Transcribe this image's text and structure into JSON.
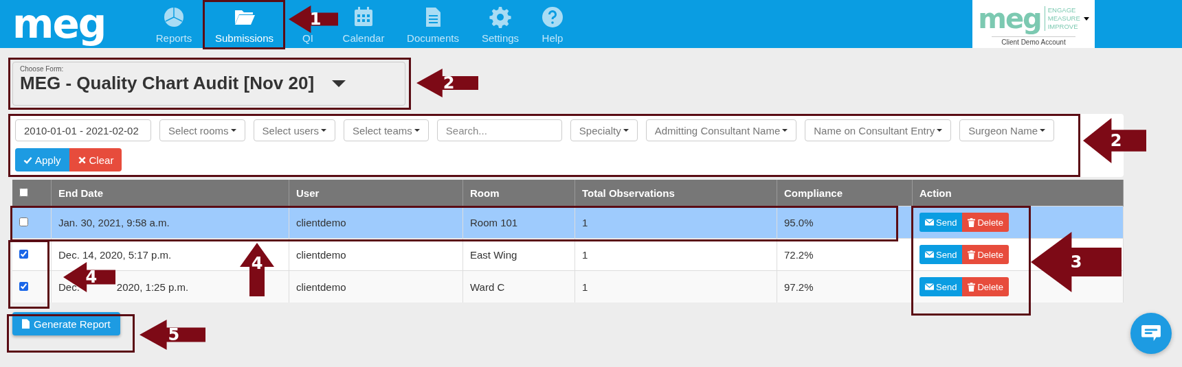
{
  "brand": "meg",
  "nav": [
    {
      "label": "Reports",
      "selected": false
    },
    {
      "label": "Submissions",
      "selected": true
    },
    {
      "label": "QI",
      "selected": false
    },
    {
      "label": "Calendar",
      "selected": false
    },
    {
      "label": "Documents",
      "selected": false
    },
    {
      "label": "Settings",
      "selected": false
    },
    {
      "label": "Help",
      "selected": false
    }
  ],
  "account": {
    "logo": "meg",
    "tagline": [
      "ENGAGE",
      "MEASURE",
      "IMPROVE"
    ],
    "name": "Client Demo Account"
  },
  "form_chooser": {
    "label": "Choose Form:",
    "value": "MEG - Quality Chart Audit [Nov 20]"
  },
  "filters": [
    {
      "kind": "value",
      "text": "2010-01-01 - 2021-02-02"
    },
    {
      "kind": "dropdown",
      "text": "Select rooms"
    },
    {
      "kind": "dropdown",
      "text": "Select users"
    },
    {
      "kind": "dropdown",
      "text": "Select teams"
    },
    {
      "kind": "search",
      "placeholder": "Search..."
    },
    {
      "kind": "dropdown",
      "text": "Specialty"
    },
    {
      "kind": "dropdown",
      "text": "Admitting Consultant Name"
    },
    {
      "kind": "dropdown",
      "text": "Name on Consultant Entry"
    },
    {
      "kind": "dropdown",
      "text": "Surgeon Name"
    }
  ],
  "filter_buttons": [
    {
      "kind": "apply",
      "label": "Apply"
    },
    {
      "kind": "clear",
      "label": "Clear"
    }
  ],
  "table": {
    "select_all": {
      "checked": false
    },
    "columns": [
      "End Date",
      "User",
      "Room",
      "Total Observations",
      "Compliance",
      "Action"
    ],
    "rows": [
      {
        "checked": false,
        "highlighted": true,
        "end_date": [
          "Jan. 30, 2021, 9:58 a.m."
        ],
        "user": "clientdemo",
        "room": "Room 101",
        "total": "1",
        "compliance": "95.0%",
        "actions": [
          "Send",
          "Delete"
        ]
      },
      {
        "checked": true,
        "highlighted": false,
        "end_date": [
          "Dec. 14, 2020, 5:17 p.m."
        ],
        "user": "clientdemo",
        "room": "East Wing",
        "total": "1",
        "compliance": "72.2%",
        "actions": [
          "Send",
          "Delete"
        ]
      },
      {
        "checked": true,
        "highlighted": false,
        "end_date": [
          "Dec.",
          "2020, 1:25 p.m."
        ],
        "user": "clientdemo",
        "room": "Ward C",
        "total": "1",
        "compliance": "97.2%",
        "actions": [
          "Send",
          "Delete"
        ]
      }
    ]
  },
  "generate_button": "Generate Report",
  "callouts": [
    {
      "label": "1",
      "kind": "left"
    },
    {
      "label": "2",
      "kind": "left"
    },
    {
      "label": "2",
      "kind": "left"
    },
    {
      "label": "3",
      "kind": "left"
    },
    {
      "label": "4",
      "kind": "up"
    },
    {
      "label": "4",
      "kind": "left"
    },
    {
      "label": "5",
      "kind": "left"
    }
  ]
}
